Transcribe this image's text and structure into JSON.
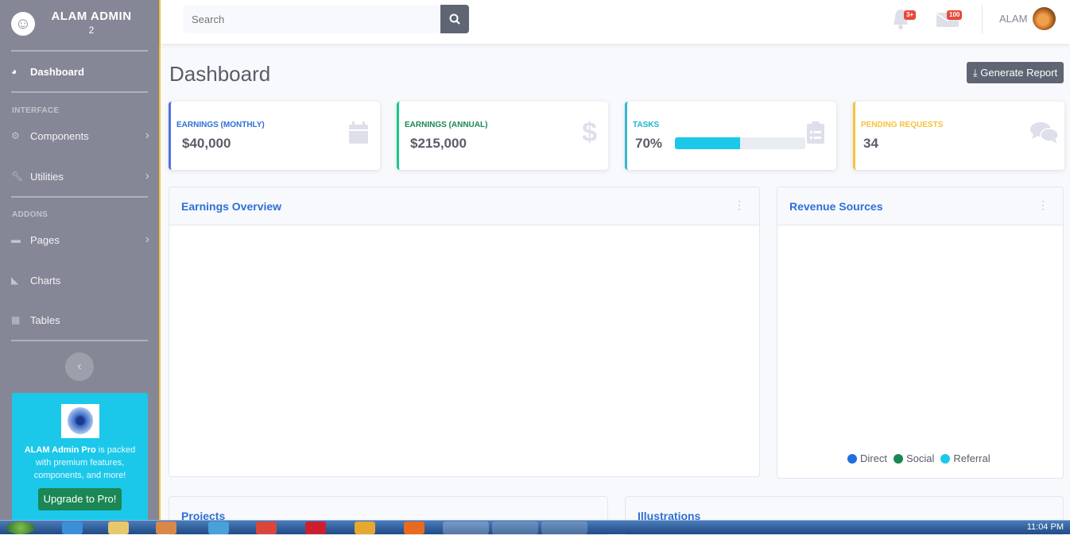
{
  "sidebar": {
    "brand": {
      "title": "ALAM ADMIN",
      "sub": "2",
      "logo": "laugh-wink-icon"
    },
    "items": [
      {
        "label": "Dashboard",
        "icon": "tachometer-icon"
      },
      {
        "label": "Components",
        "icon": "cog-icon"
      },
      {
        "label": "Utilities",
        "icon": "wrench-icon"
      },
      {
        "label": "Pages",
        "icon": "folder-icon"
      },
      {
        "label": "Charts",
        "icon": "chart-area-icon"
      },
      {
        "label": "Tables",
        "icon": "table-icon"
      }
    ],
    "headings": {
      "interface": "INTERFACE",
      "addons": "ADDONS"
    },
    "promo": {
      "brand": "ALAM Admin Pro",
      "text": " is packed with premium features, components, and more!",
      "button": "Upgrade to Pro!"
    }
  },
  "topbar": {
    "search_placeholder": "Search",
    "alerts_badge": "3+",
    "messages_badge": "100",
    "user": "ALAM"
  },
  "page": {
    "title": "Dashboard",
    "generate_button": "Generate Report"
  },
  "cards": [
    {
      "label": "EARNINGS (MONTHLY)",
      "value": "$40,000",
      "color": "#4e73df",
      "icon": "calendar-icon"
    },
    {
      "label": "EARNINGS (ANNUAL)",
      "value": "$215,000",
      "color": "#1cc88a",
      "icon": "dollar-icon"
    },
    {
      "label": "TASKS",
      "value": "70%",
      "progress": 0.5,
      "color": "#36b9cc",
      "icon": "clipboard-list-icon"
    },
    {
      "label": "PENDING REQUESTS",
      "value": "34",
      "color": "#f6c23e",
      "icon": "comments-icon"
    }
  ],
  "panels": {
    "earnings": "Earnings Overview",
    "revenue": "Revenue Sources",
    "projects": "Projects",
    "illustrations": "Illustrations"
  },
  "legend": [
    {
      "label": "Direct",
      "color": "#1f6fe0"
    },
    {
      "label": "Social",
      "color": "#1a8754"
    },
    {
      "label": "Referral",
      "color": "#1cc8e9"
    }
  ],
  "taskbar": {
    "clock": "11:04 PM"
  }
}
